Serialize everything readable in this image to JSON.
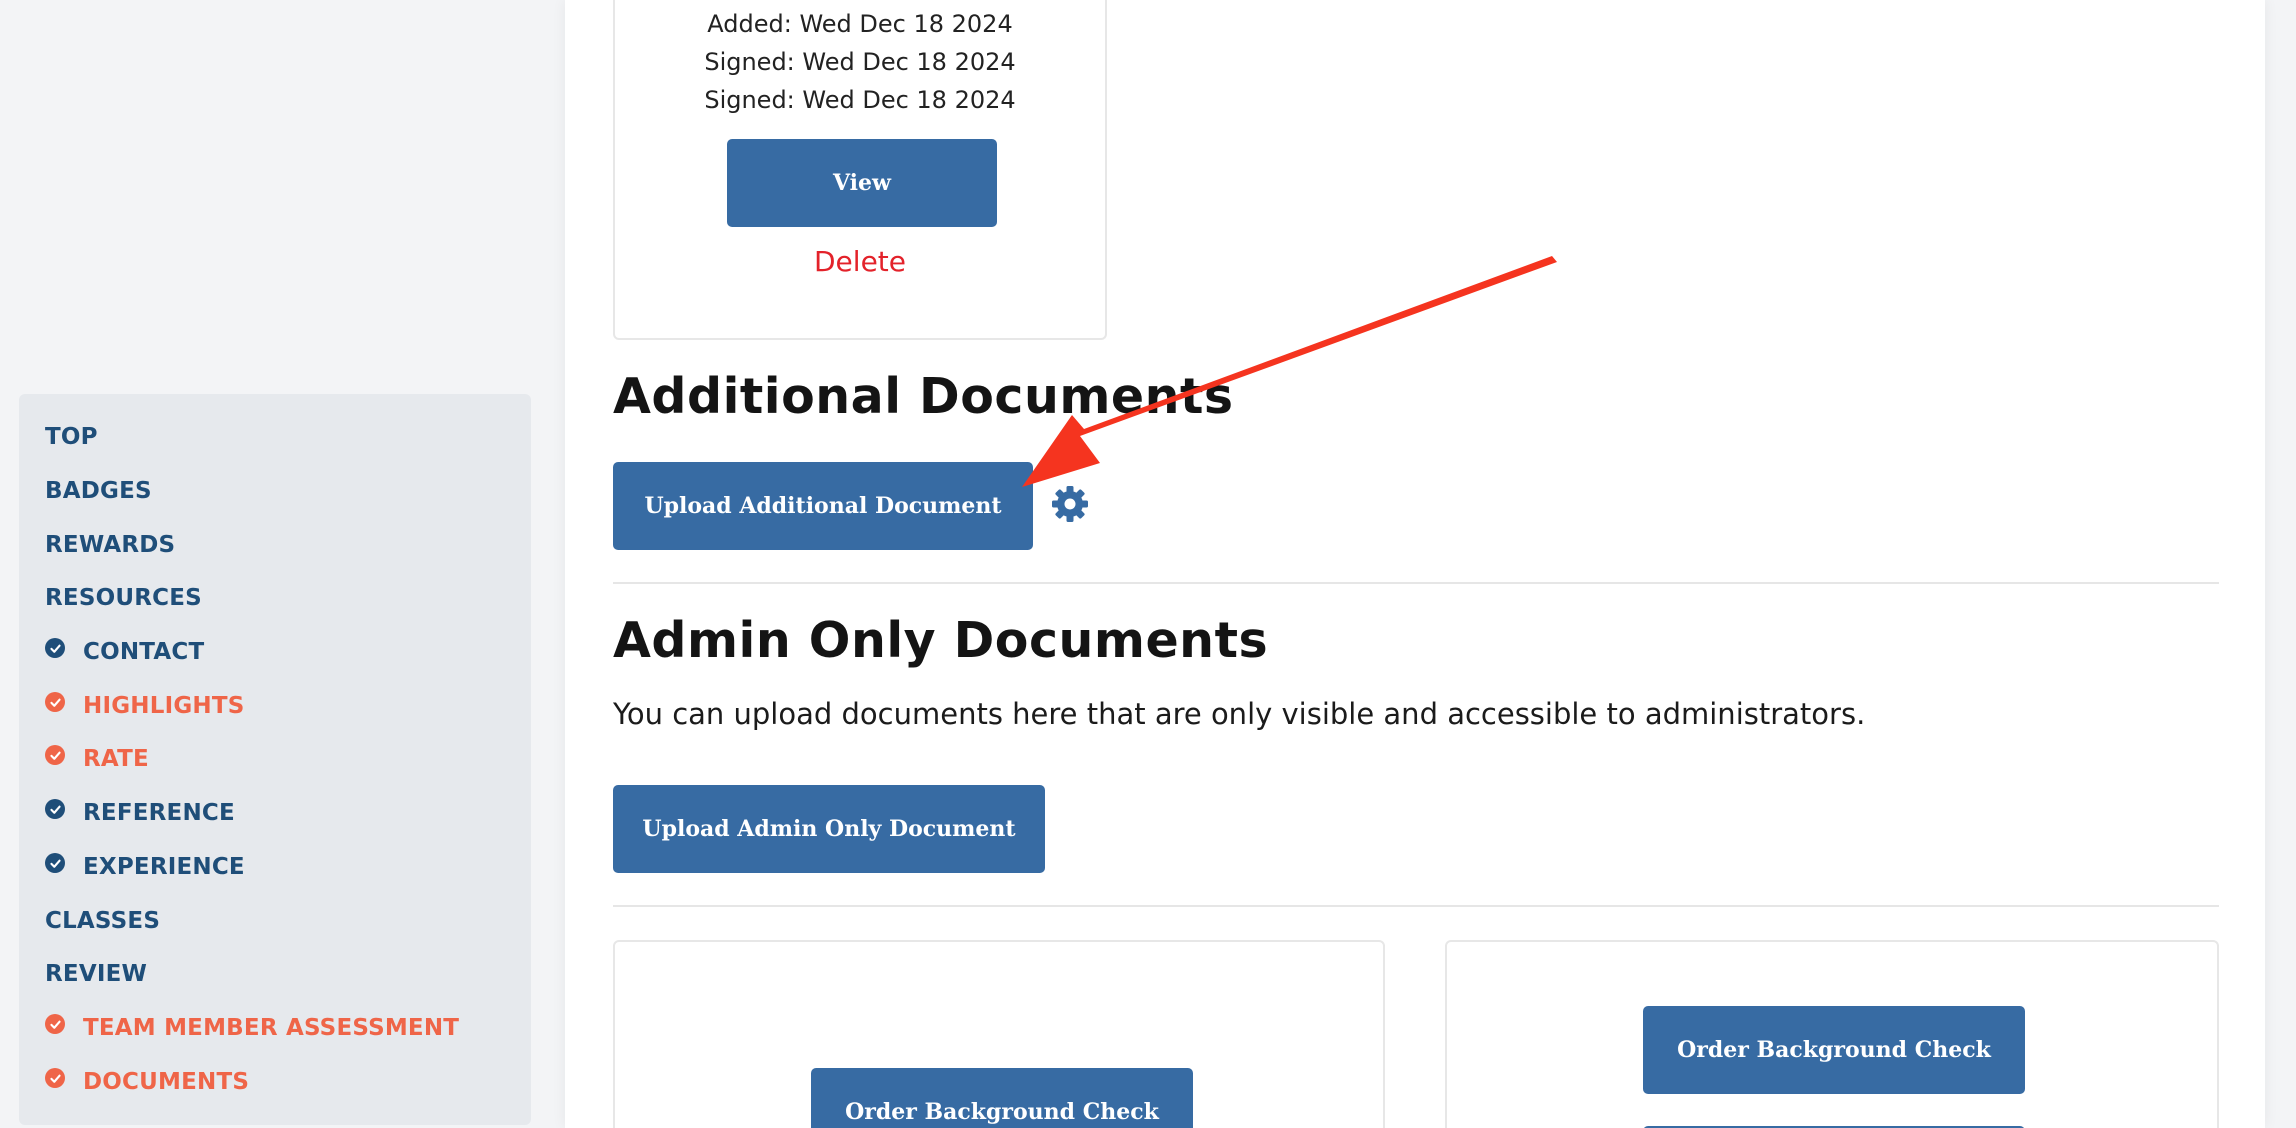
{
  "sidebar": {
    "items": [
      {
        "label": "TOP",
        "checked": false,
        "state": "default"
      },
      {
        "label": "BADGES",
        "checked": false,
        "state": "default"
      },
      {
        "label": "REWARDS",
        "checked": false,
        "state": "default"
      },
      {
        "label": "RESOURCES",
        "checked": false,
        "state": "default"
      },
      {
        "label": "CONTACT",
        "checked": true,
        "state": "complete"
      },
      {
        "label": "HIGHLIGHTS",
        "checked": true,
        "state": "attention"
      },
      {
        "label": "RATE",
        "checked": true,
        "state": "attention"
      },
      {
        "label": "REFERENCE",
        "checked": true,
        "state": "complete"
      },
      {
        "label": "EXPERIENCE",
        "checked": true,
        "state": "complete"
      },
      {
        "label": "CLASSES",
        "checked": false,
        "state": "default"
      },
      {
        "label": "REVIEW",
        "checked": false,
        "state": "default"
      },
      {
        "label": "TEAM MEMBER ASSESSMENT",
        "checked": true,
        "state": "attention"
      },
      {
        "label": "DOCUMENTS",
        "checked": true,
        "state": "attention"
      }
    ]
  },
  "doc_card": {
    "added": "Added: Wed Dec 18 2024",
    "signed_1": "Signed: Wed Dec 18 2024",
    "signed_2": "Signed: Wed Dec 18 2024",
    "view_label": "View",
    "delete_label": "Delete"
  },
  "additional": {
    "title": "Additional Documents",
    "upload_label": "Upload Additional Document",
    "settings_icon": "gear-icon"
  },
  "admin": {
    "title": "Admin Only Documents",
    "description": "You can upload documents here that are only visible and accessible to administrators.",
    "upload_label": "Upload Admin Only Document"
  },
  "background_checks": {
    "left_label": "Order Background Check",
    "right_label": "Order Background Check"
  },
  "colors": {
    "primary": "#376ba3",
    "nav_text": "#1f4e79",
    "nav_attention": "#ef6548",
    "delete": "#e3222a",
    "annotation": "#f5341f"
  }
}
